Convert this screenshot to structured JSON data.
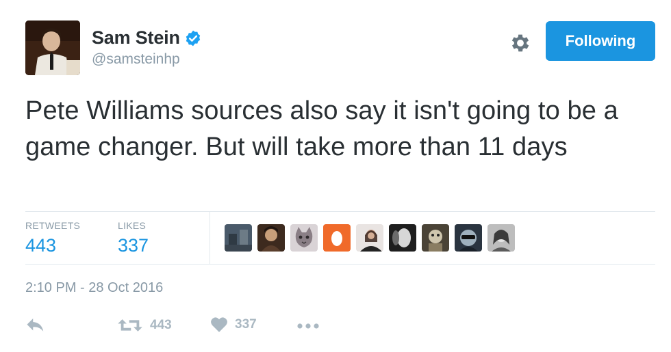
{
  "user": {
    "name": "Sam Stein",
    "handle": "@samsteinhp",
    "verified": true
  },
  "header": {
    "gear_icon": "gear-icon",
    "follow_label": "Following"
  },
  "tweet": {
    "text": "Pete Williams sources also say it isn't going to be a game changer. But will take more than 11 days"
  },
  "stats": {
    "retweets_label": "RETWEETS",
    "retweets_value": "443",
    "likes_label": "LIKES",
    "likes_value": "337"
  },
  "timestamp": "2:10 PM - 28 Oct 2016",
  "actions": {
    "reply_icon": "reply-icon",
    "retweet_icon": "retweet-icon",
    "retweet_count": "443",
    "like_icon": "heart-icon",
    "like_count": "337",
    "more_icon": "more-dots-icon"
  },
  "colors": {
    "accent": "#1b95e0",
    "muted": "#8899a6",
    "icon": "#aab8c2",
    "text": "#292f33"
  }
}
